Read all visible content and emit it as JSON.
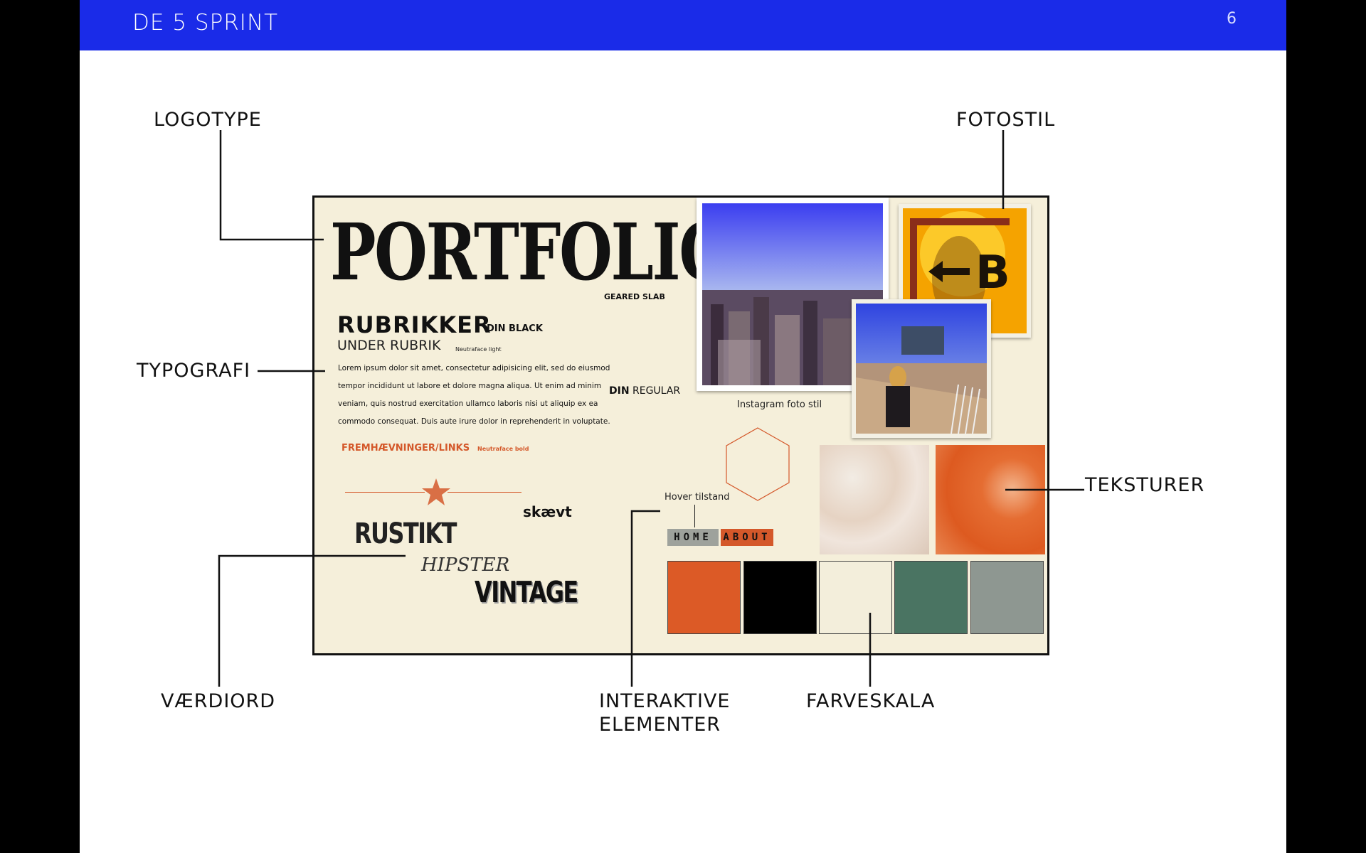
{
  "header": {
    "title": "DE 5 SPRINT",
    "page_number": "6",
    "bg_color": "#1a2be8"
  },
  "labels": {
    "logotype": "LOGOTYPE",
    "fotostil": "FOTOSTIL",
    "typografi": "TYPOGRAFI",
    "teksturer": "TEKSTURER",
    "vaerdiord": "VÆRDIORD",
    "interaktive_1": "INTERAKTIVE",
    "interaktive_2": "ELEMENTER",
    "farveskala": "FARVESKALA"
  },
  "board": {
    "logo": "PORTFOLIO",
    "logo_font_caption": "GEARED SLAB",
    "heading": "RUBRIKKER",
    "heading_font": "DIN BLACK",
    "subheading": "UNDER RUBRIK",
    "subheading_font": "Neutraface light",
    "body_text": "Lorem ipsum dolor sit amet, consectetur adipisicing elit, sed do eiusmod tempor incididunt ut labore et dolore magna aliqua. Ut enim ad minim veniam, quis nostrud exercitation ullamco laboris nisi ut aliquip ex ea commodo consequat. Duis aute irure dolor in reprehenderit in voluptate.",
    "body_font_bold": "DIN",
    "body_font_rest": "REGULAR",
    "highlight": "FREMHÆVNINGER/LINKS",
    "highlight_font": "Neutraface bold",
    "word_skaevt": "skævt",
    "word_rustikt": "RUSTIKT",
    "word_hipster": "HIPSTER",
    "word_vintage": "VINTAGE",
    "photo_caption": "Instagram foto stil",
    "hover_label": "Hover tilstand",
    "nav_home": "HOME",
    "nav_about": "ABOUT"
  },
  "palette": {
    "board_bg": "#f5efda",
    "accent": "#d4582a",
    "swatches": [
      "#dc5a26",
      "#000000",
      "#f3eedb",
      "#4a7462",
      "#8e9791"
    ]
  },
  "icons": [
    "star-icon",
    "hexagon-icon",
    "left-arrow-icon"
  ]
}
